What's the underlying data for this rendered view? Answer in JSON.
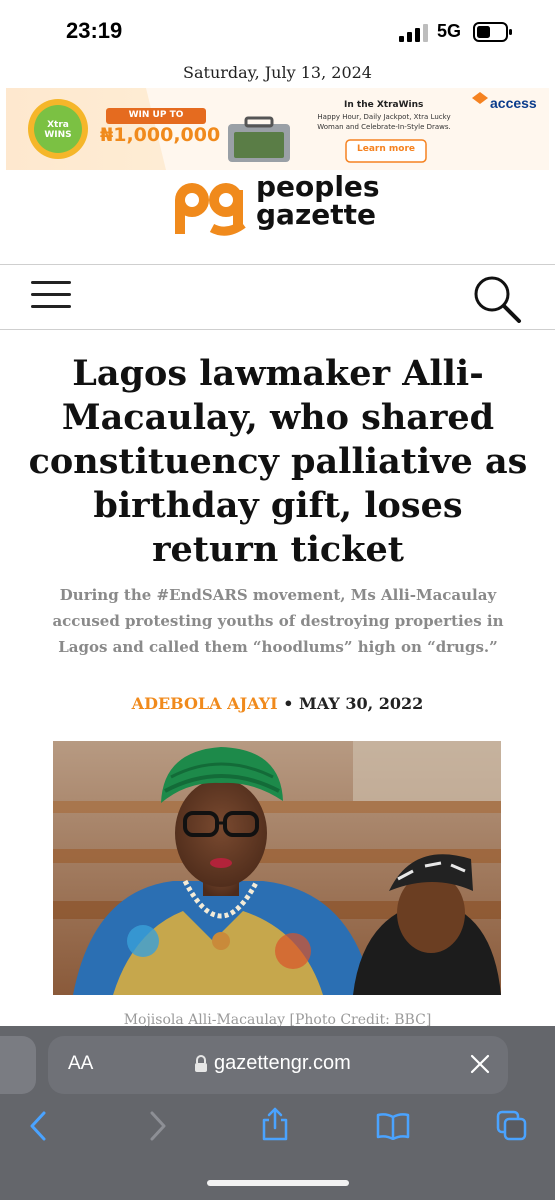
{
  "status_bar": {
    "time": "23:19",
    "network": "5G",
    "icons": [
      "signal-bars-icon",
      "battery-icon"
    ]
  },
  "date_line": "Saturday, July 13, 2024",
  "ad": {
    "brand_badge": "Xtra WINS",
    "win_up_to": "WIN UP TO",
    "amount": "₦1,000,000",
    "title": "In the XtraWins",
    "body": "Happy Hour, Daily Jackpot, Xtra Lucky Woman and Celebrate-In-Style Draws.",
    "cta": "Learn more",
    "advertiser": "access"
  },
  "site": {
    "logo_mark": "pg",
    "logo_line1": "peoples",
    "logo_line2": "gazette",
    "brand_color": "#f08a1c"
  },
  "nav": {
    "menu_icon": "hamburger-menu-icon",
    "search_icon": "search-icon"
  },
  "article": {
    "headline": "Lagos lawmaker Alli-Macaulay, who shared constituency palliative as birthday gift, loses return ticket",
    "subheadline": "During the #EndSARS movement, Ms Alli-Macaulay accused protesting youths of destroying properties in Lagos and called them “hoodlums” high on “drugs.”",
    "author": "ADEBOLA AJAYI",
    "separator": "•",
    "date": "MAY 30, 2022",
    "photo_caption": "Mojisola Alli-Macaulay [Photo Credit: BBC]"
  },
  "browser": {
    "aa_label": "AA",
    "url": "gazettengr.com",
    "buttons": [
      "back-icon",
      "forward-icon",
      "share-icon",
      "bookmarks-icon",
      "tabs-icon"
    ]
  }
}
